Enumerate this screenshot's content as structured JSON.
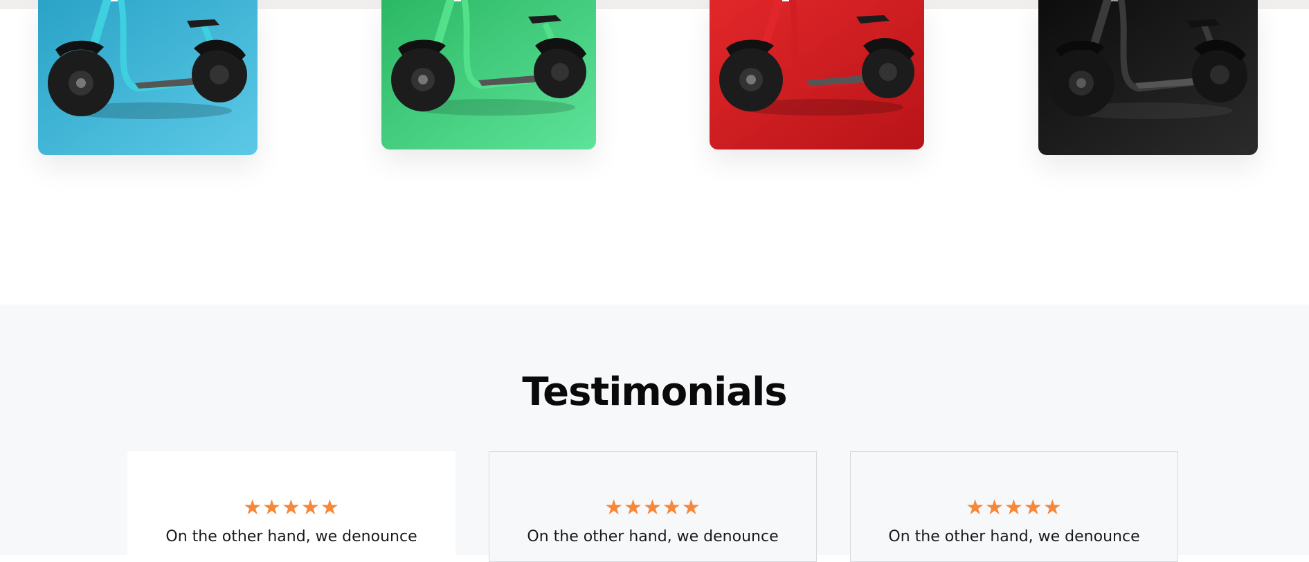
{
  "products": [
    {
      "name": "scooter-blue",
      "color_name": "blue",
      "bg_from": "#2aa3c7",
      "bg_to": "#5cc9e6",
      "frame": "#3fd0e0"
    },
    {
      "name": "scooter-green",
      "color_name": "green",
      "bg_from": "#2bb864",
      "bg_to": "#5ee39a",
      "frame": "#52e08a"
    },
    {
      "name": "scooter-red",
      "color_name": "red",
      "bg_from": "#e2272a",
      "bg_to": "#b81418",
      "frame": "#e0262a"
    },
    {
      "name": "scooter-black",
      "color_name": "black",
      "bg_from": "#0d0d0d",
      "bg_to": "#2b2b2b",
      "frame": "#2a2a2a"
    }
  ],
  "testimonials": {
    "title": "Testimonials",
    "items": [
      {
        "rating": 5,
        "stars": "★★★★★",
        "text": "On the other hand, we denounce"
      },
      {
        "rating": 5,
        "stars": "★★★★★",
        "text": "On the other hand, we denounce"
      },
      {
        "rating": 5,
        "stars": "★★★★★",
        "text": "On the other hand, we denounce"
      }
    ]
  },
  "colors": {
    "star": "#f5883a",
    "section_bg": "#f7f8fa"
  }
}
